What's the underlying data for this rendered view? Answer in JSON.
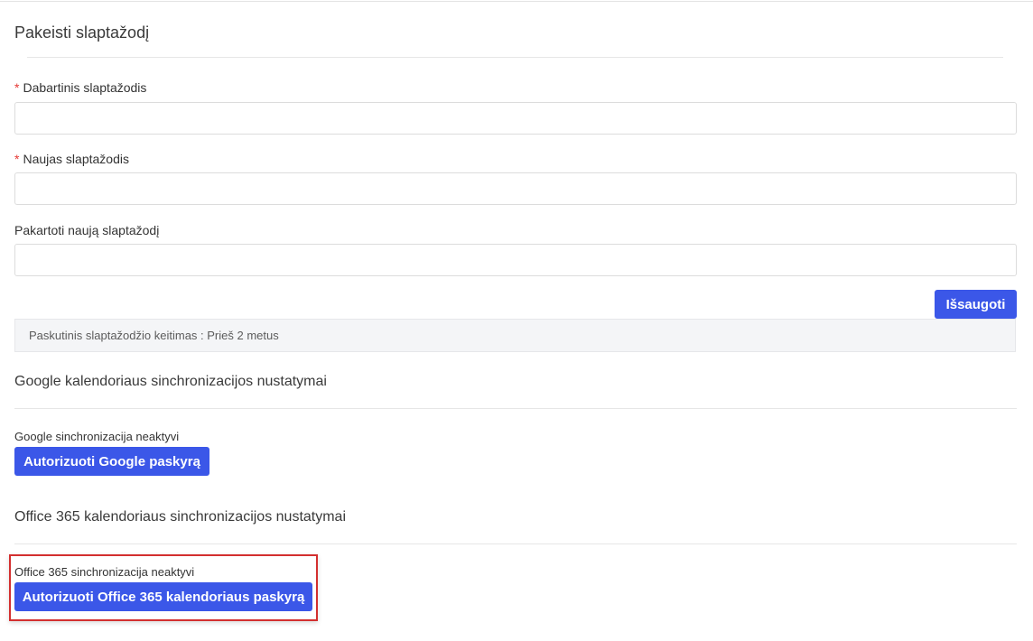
{
  "password_section": {
    "title": "Pakeisti slaptažodį",
    "required_mark": "*",
    "current_password_label": "Dabartinis slaptažodis",
    "current_password_value": "",
    "new_password_label": "Naujas slaptažodis",
    "new_password_value": "",
    "repeat_password_label": "Pakartoti naują slaptažodį",
    "repeat_password_value": "",
    "save_label": "Išsaugoti",
    "last_change_text": "Paskutinis slaptažodžio keitimas : Prieš 2 metus"
  },
  "google_section": {
    "title": "Google kalendoriaus sinchronizacijos nustatymai",
    "status_text": "Google sinchronizacija neaktyvi",
    "authorize_label": "Autorizuoti Google paskyrą"
  },
  "office_section": {
    "title": "Office 365 kalendoriaus sinchronizacijos nustatymai",
    "status_text": "Office 365 sinchronizacija neaktyvi",
    "authorize_label": "Autorizuoti Office 365 kalendoriaus paskyrą"
  },
  "colors": {
    "accent": "#3b57e8",
    "required": "#e53935",
    "highlight": "#d32f2f"
  }
}
